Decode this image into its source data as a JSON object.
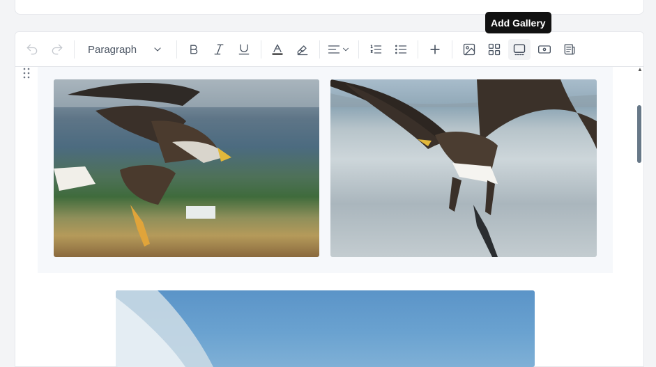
{
  "toolbar": {
    "block_type": "Paragraph",
    "tooltip": "Add Gallery",
    "tools": [
      {
        "name": "undo",
        "enabled": false
      },
      {
        "name": "redo",
        "enabled": false
      },
      {
        "name": "bold"
      },
      {
        "name": "italic"
      },
      {
        "name": "underline"
      },
      {
        "name": "text-color"
      },
      {
        "name": "highlight"
      },
      {
        "name": "align"
      },
      {
        "name": "ordered-list"
      },
      {
        "name": "bullet-list"
      },
      {
        "name": "insert"
      },
      {
        "name": "image"
      },
      {
        "name": "gallery"
      },
      {
        "name": "slideshow",
        "active": true
      },
      {
        "name": "embed-video"
      },
      {
        "name": "news-embed"
      }
    ]
  },
  "gallery": {
    "images": [
      {
        "subject": "eagle-gliding"
      },
      {
        "subject": "eagle-catching-fish"
      }
    ]
  },
  "colors": {
    "tooltip_bg": "#111111",
    "scrollbar": "#677888",
    "gallery_bg": "#f6f8fb"
  }
}
